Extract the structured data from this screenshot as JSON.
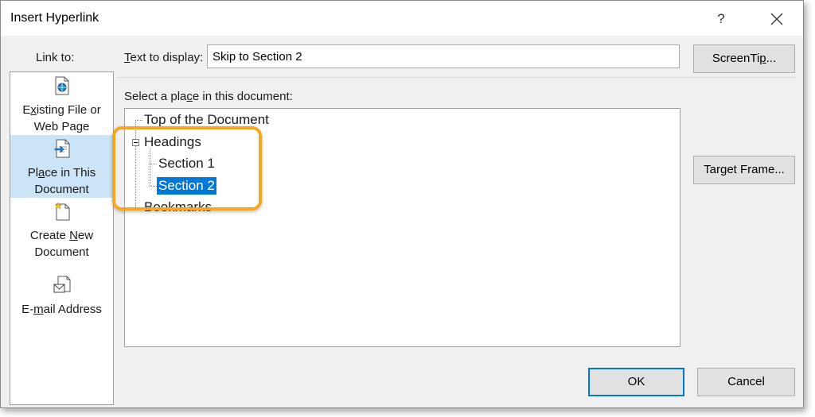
{
  "dialog": {
    "title": "Insert Hyperlink",
    "help_label": "?",
    "close_icon": "close-icon"
  },
  "link_to": {
    "label": "Link to:",
    "items": [
      {
        "pre": "E",
        "u": "x",
        "post": "isting File or",
        "line2": "Web Page",
        "icon": "document-globe-icon",
        "selected": false
      },
      {
        "pre": "Pl",
        "u": "a",
        "post": "ce in This",
        "line2": "Document",
        "icon": "document-arrow-icon",
        "selected": true
      },
      {
        "pre": "Create ",
        "u": "N",
        "post": "ew",
        "line2": "Document",
        "icon": "new-document-icon",
        "selected": false
      },
      {
        "pre": "E-",
        "u": "m",
        "post": "ail Address",
        "line2": "",
        "icon": "envelope-icon",
        "selected": false
      }
    ]
  },
  "text_to_display": {
    "label_u": "T",
    "label_rest": "ext to display:",
    "value": "Skip to Section 2"
  },
  "screentip_button": {
    "pre": "ScreenTi",
    "u": "p",
    "post": "..."
  },
  "place": {
    "label_pre": "Select a pla",
    "label_u": "c",
    "label_post": "e in this document:",
    "tree": {
      "top": "Top of the Document",
      "headings": "Headings",
      "section1": "Section 1",
      "section2": "Section 2",
      "bookmarks": "Bookmarks"
    },
    "selected": "Section 2"
  },
  "target_frame_button": {
    "pre": "Tar",
    "u": "g",
    "post": "et Frame..."
  },
  "ok_button": "OK",
  "cancel_button": "Cancel",
  "colors": {
    "selection": "#0078d7",
    "sidebar_selected": "#cce4f7",
    "callout": "#f5a623"
  }
}
